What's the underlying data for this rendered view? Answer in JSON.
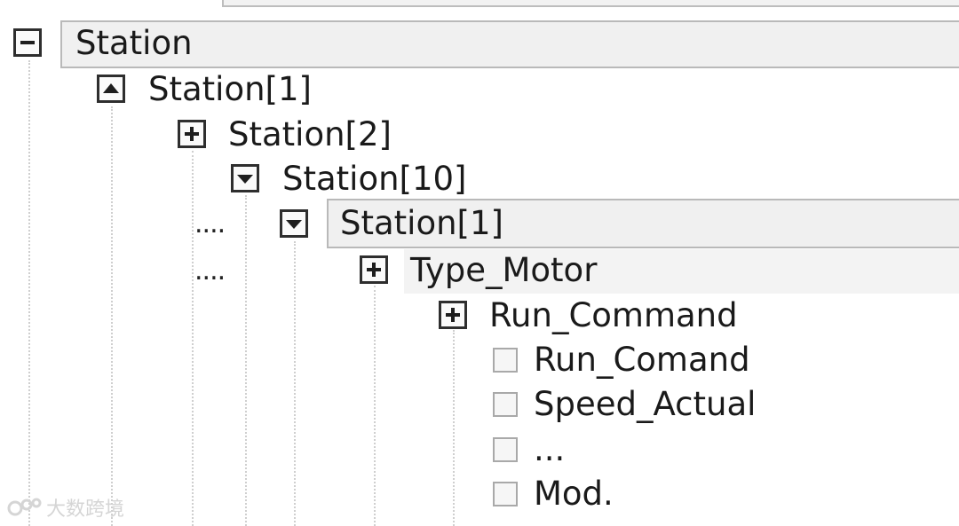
{
  "tree": {
    "items": [
      {
        "label": "Station",
        "control": "minus"
      },
      {
        "label": "Station[1]",
        "control": "up"
      },
      {
        "label": "Station[2]",
        "control": "plus"
      },
      {
        "label": "Station[10]",
        "control": "down"
      },
      {
        "label": "Station[1]",
        "control": "down",
        "prefix": "...."
      },
      {
        "label": "Type_Motor",
        "control": "plus",
        "prefix": "...."
      },
      {
        "label": "Run_Command",
        "control": "plus"
      },
      {
        "label": "Run_Comand",
        "control": "checkbox"
      },
      {
        "label": "Speed_Actual",
        "control": "checkbox"
      },
      {
        "label": "...",
        "control": "checkbox"
      },
      {
        "label": "Mod.",
        "control": "checkbox"
      }
    ]
  },
  "watermark": {
    "text": "大数跨境"
  }
}
